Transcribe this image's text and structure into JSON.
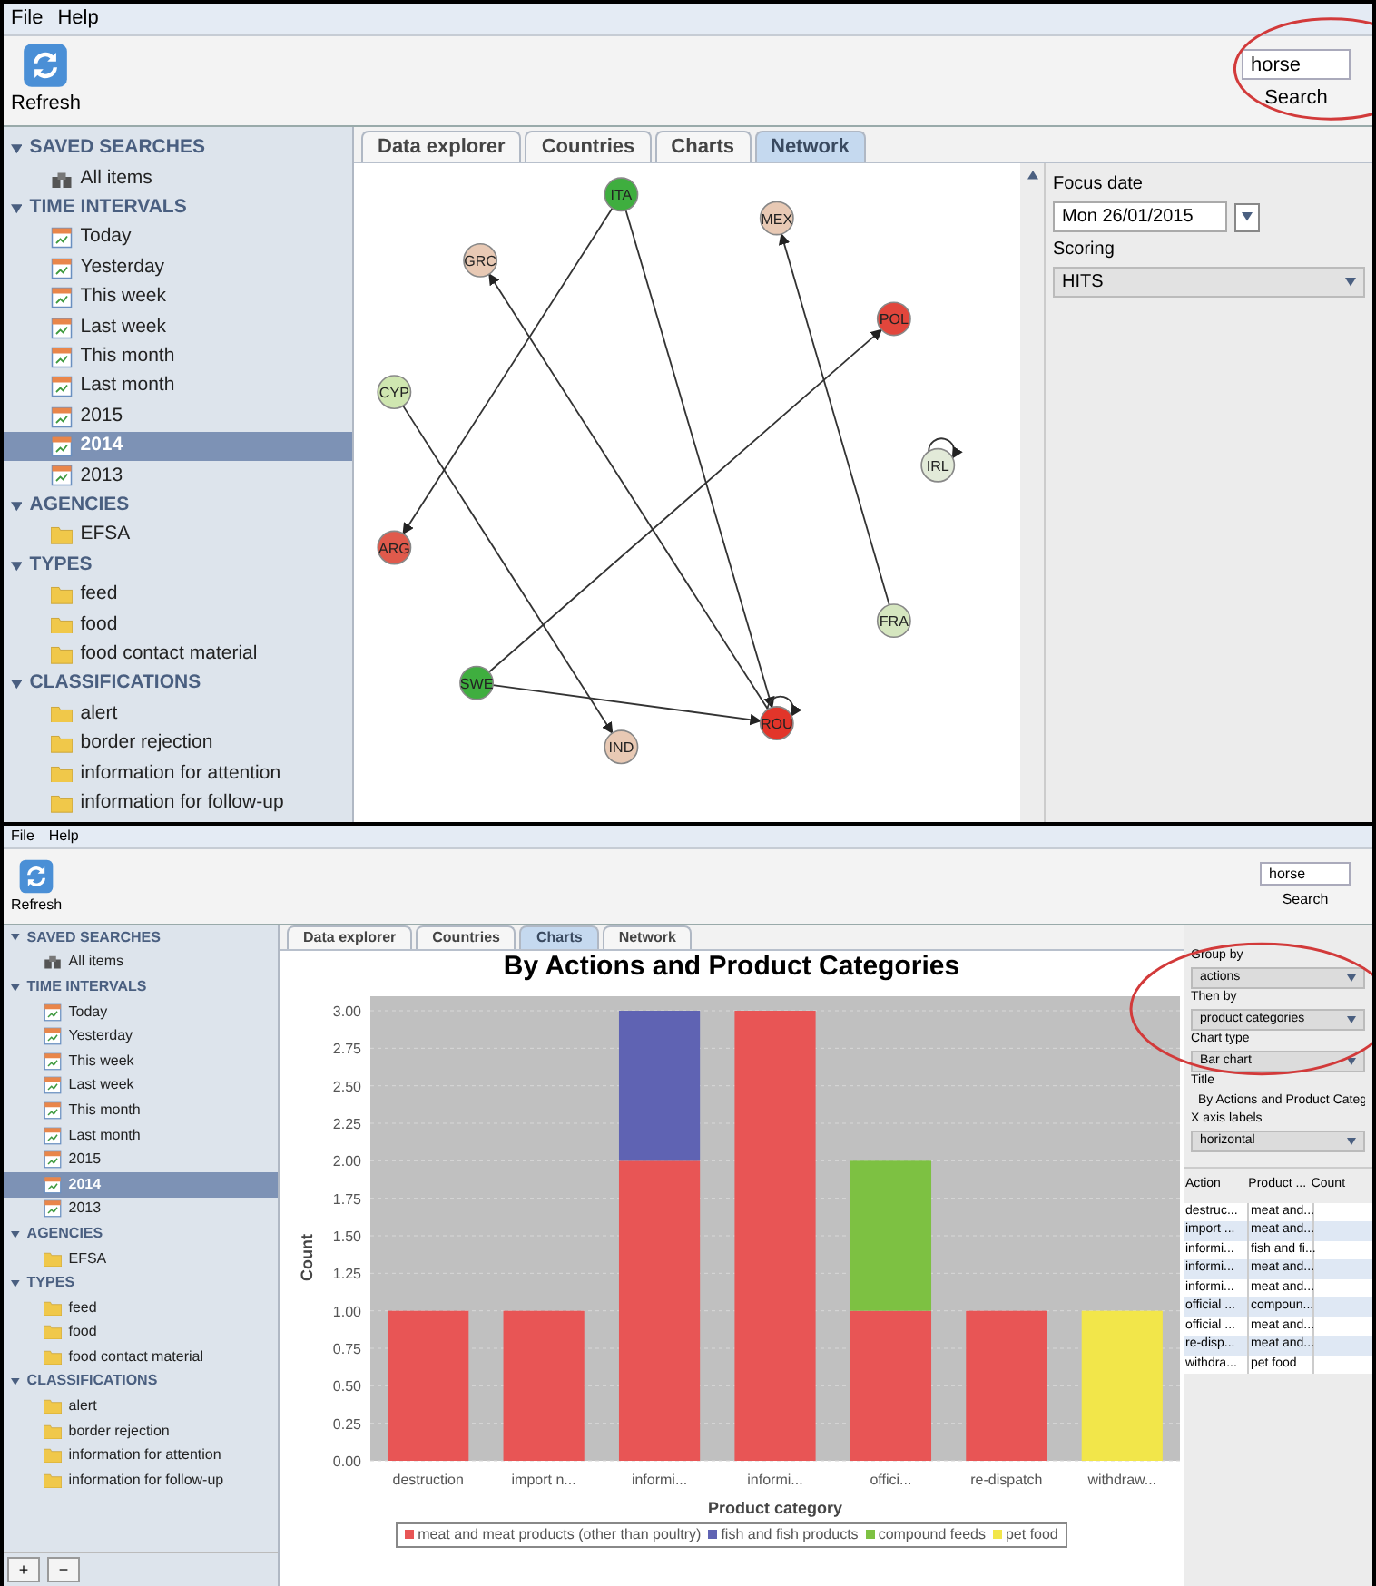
{
  "top": {
    "menu": [
      "File",
      "Help"
    ],
    "toolbar": {
      "refresh": "Refresh",
      "search_value": "horse",
      "search_button": "Search"
    },
    "sidebar": [
      {
        "title": "SAVED SEARCHES",
        "expanded": true,
        "items": [
          {
            "label": "All items",
            "kind": "binoculars",
            "selected": false
          }
        ]
      },
      {
        "title": "TIME INTERVALS",
        "expanded": true,
        "items": [
          {
            "label": "Today",
            "kind": "calendar",
            "selected": false
          },
          {
            "label": "Yesterday",
            "kind": "calendar",
            "selected": false
          },
          {
            "label": "This week",
            "kind": "calendar",
            "selected": false
          },
          {
            "label": "Last week",
            "kind": "calendar",
            "selected": false
          },
          {
            "label": "This month",
            "kind": "calendar",
            "selected": false
          },
          {
            "label": "Last month",
            "kind": "calendar",
            "selected": false
          },
          {
            "label": "2015",
            "kind": "calendar",
            "selected": false
          },
          {
            "label": "2014",
            "kind": "calendar",
            "selected": true
          },
          {
            "label": "2013",
            "kind": "calendar",
            "selected": false
          }
        ]
      },
      {
        "title": "AGENCIES",
        "expanded": true,
        "items": [
          {
            "label": "EFSA",
            "kind": "folder",
            "selected": false
          }
        ]
      },
      {
        "title": "TYPES",
        "expanded": true,
        "items": [
          {
            "label": "feed",
            "kind": "folder",
            "selected": false
          },
          {
            "label": "food",
            "kind": "folder",
            "selected": false
          },
          {
            "label": "food contact material",
            "kind": "folder",
            "selected": false
          }
        ]
      },
      {
        "title": "CLASSIFICATIONS",
        "expanded": true,
        "items": [
          {
            "label": "alert",
            "kind": "folder",
            "selected": false
          },
          {
            "label": "border rejection",
            "kind": "folder",
            "selected": false
          },
          {
            "label": "information for attention",
            "kind": "folder",
            "selected": false
          },
          {
            "label": "information for follow-up",
            "kind": "folder",
            "selected": false
          }
        ]
      }
    ],
    "tabs": [
      {
        "label": "Data explorer",
        "selected": false
      },
      {
        "label": "Countries",
        "selected": false
      },
      {
        "label": "Charts",
        "selected": false
      },
      {
        "label": "Network",
        "selected": true
      }
    ],
    "network_nodes": [
      {
        "label": "ITA",
        "color": "#3fae3f"
      },
      {
        "label": "GRC",
        "color": "#e8c9b4"
      },
      {
        "label": "MEX",
        "color": "#e8c9b4"
      },
      {
        "label": "POL",
        "color": "#e2463c"
      },
      {
        "label": "CYP",
        "color": "#cfe6b0"
      },
      {
        "label": "IRL",
        "color": "#e2ead8"
      },
      {
        "label": "ARG",
        "color": "#e05a4c"
      },
      {
        "label": "FRA",
        "color": "#d5e6bf"
      },
      {
        "label": "SWE",
        "color": "#3fae3f"
      },
      {
        "label": "IND",
        "color": "#e8c9b4"
      },
      {
        "label": "ROU",
        "color": "#e2352a"
      }
    ],
    "settings": {
      "focus_date_label": "Focus date",
      "focus_date": "Mon 26/01/2015",
      "scoring_label": "Scoring",
      "scoring": "HITS"
    }
  },
  "bottom": {
    "menu": [
      "File",
      "Help"
    ],
    "toolbar": {
      "refresh": "Refresh",
      "search_value": "horse",
      "search_button": "Search"
    },
    "sidebar": [
      {
        "title": "SAVED SEARCHES",
        "expanded": true,
        "items": [
          {
            "label": "All items",
            "kind": "binoculars",
            "selected": false
          }
        ]
      },
      {
        "title": "TIME INTERVALS",
        "expanded": true,
        "items": [
          {
            "label": "Today",
            "kind": "calendar",
            "selected": false
          },
          {
            "label": "Yesterday",
            "kind": "calendar",
            "selected": false
          },
          {
            "label": "This week",
            "kind": "calendar",
            "selected": false
          },
          {
            "label": "Last week",
            "kind": "calendar",
            "selected": false
          },
          {
            "label": "This month",
            "kind": "calendar",
            "selected": false
          },
          {
            "label": "Last month",
            "kind": "calendar",
            "selected": false
          },
          {
            "label": "2015",
            "kind": "calendar",
            "selected": false
          },
          {
            "label": "2014",
            "kind": "calendar",
            "selected": true
          },
          {
            "label": "2013",
            "kind": "calendar",
            "selected": false
          }
        ]
      },
      {
        "title": "AGENCIES",
        "expanded": true,
        "items": [
          {
            "label": "EFSA",
            "kind": "folder",
            "selected": false
          }
        ]
      },
      {
        "title": "TYPES",
        "expanded": true,
        "items": [
          {
            "label": "feed",
            "kind": "folder",
            "selected": false
          },
          {
            "label": "food",
            "kind": "folder",
            "selected": false
          },
          {
            "label": "food contact material",
            "kind": "folder",
            "selected": false
          }
        ]
      },
      {
        "title": "CLASSIFICATIONS",
        "expanded": true,
        "items": [
          {
            "label": "alert",
            "kind": "folder",
            "selected": false
          },
          {
            "label": "border rejection",
            "kind": "folder",
            "selected": false
          },
          {
            "label": "information for attention",
            "kind": "folder",
            "selected": false
          },
          {
            "label": "information for follow-up",
            "kind": "folder",
            "selected": false
          }
        ]
      }
    ],
    "sidebar_buttons": [
      "+",
      "−"
    ],
    "tabs": [
      {
        "label": "Data explorer",
        "selected": false
      },
      {
        "label": "Countries",
        "selected": false
      },
      {
        "label": "Charts",
        "selected": true
      },
      {
        "label": "Network",
        "selected": false
      }
    ],
    "chart_data": {
      "type": "bar",
      "title": "By Actions and Product Categories",
      "xlabel": "Product category",
      "ylabel": "Count",
      "stacked": true,
      "categories": [
        "destruction",
        "import n...",
        "informi...",
        "informi...",
        "offici...",
        "re-dispatch",
        "withdraw..."
      ],
      "series": [
        {
          "name": "meat and meat products (other than poultry)",
          "color": "#e85555",
          "values": [
            1,
            1,
            2,
            3,
            1,
            1,
            0
          ]
        },
        {
          "name": "fish and fish products",
          "color": "#5f63b3",
          "values": [
            0,
            0,
            1,
            0,
            0,
            0,
            0
          ]
        },
        {
          "name": "compound feeds",
          "color": "#7dc142",
          "values": [
            0,
            0,
            0,
            0,
            1,
            0,
            0
          ]
        },
        {
          "name": "pet food",
          "color": "#f2e64a",
          "values": [
            0,
            0,
            0,
            0,
            0,
            0,
            1
          ]
        }
      ],
      "ylim": [
        0,
        3
      ],
      "grid": true,
      "legend": true,
      "yticks": [
        {
          "value": 0,
          "label": "0.00"
        },
        {
          "value": 0.25,
          "label": "0.25"
        },
        {
          "value": 0.5,
          "label": "0.50"
        },
        {
          "value": 0.75,
          "label": "0.75"
        },
        {
          "value": 1,
          "label": "1.00"
        },
        {
          "value": 1.25,
          "label": "1.25"
        },
        {
          "value": 1.5,
          "label": "1.50"
        },
        {
          "value": 1.75,
          "label": "1.75"
        },
        {
          "value": 2,
          "label": "2.00"
        },
        {
          "value": 2.25,
          "label": "2.25"
        },
        {
          "value": 2.5,
          "label": "2.50"
        },
        {
          "value": 2.75,
          "label": "2.75"
        },
        {
          "value": 3,
          "label": "3.00"
        }
      ]
    },
    "settings": [
      {
        "label": "Group by",
        "value": "actions",
        "kind": "select"
      },
      {
        "label": "Then by",
        "value": "product categories",
        "kind": "select"
      },
      {
        "label": "Chart type",
        "value": "Bar chart",
        "kind": "select"
      },
      {
        "label": "Title",
        "value": "By Actions and Product Categ",
        "kind": "text"
      },
      {
        "label": "X axis labels",
        "value": "horizontal",
        "kind": "select"
      }
    ],
    "table": {
      "columns": [
        "Action",
        "Product ...",
        "Count"
      ],
      "rows": [
        [
          "destruc...",
          "meat and..."
        ],
        [
          "import ...",
          "meat and..."
        ],
        [
          "informi...",
          "fish and fi..."
        ],
        [
          "informi...",
          "meat and..."
        ],
        [
          "informi...",
          "meat and..."
        ],
        [
          "official ...",
          "compoun..."
        ],
        [
          "official ...",
          "meat and..."
        ],
        [
          "re-disp...",
          "meat and..."
        ],
        [
          "withdra...",
          "pet food"
        ]
      ]
    }
  }
}
